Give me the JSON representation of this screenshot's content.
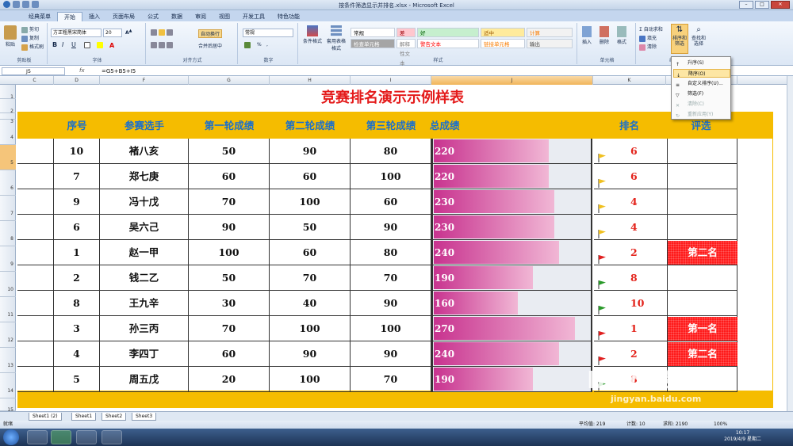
{
  "window": {
    "title": "按条件筛选显示并排名.xlsx - Microsoft Excel",
    "minimize": "–",
    "maximize": "□",
    "close": "✕"
  },
  "tabs": [
    "经典菜单",
    "开始",
    "插入",
    "页面布局",
    "公式",
    "数据",
    "审阅",
    "视图",
    "开发工具",
    "特色功能"
  ],
  "active_tab": "开始",
  "ribbon": {
    "clipboard": {
      "label": "剪贴板",
      "paste": "粘贴",
      "cut": "剪切",
      "copy": "复制",
      "format_painter": "格式刷"
    },
    "font": {
      "label": "字体",
      "name": "方正粗黑宋简体",
      "size": "20",
      "bold": "B",
      "italic": "I",
      "underline": "U"
    },
    "alignment": {
      "label": "对齐方式",
      "wrap": "自动换行",
      "merge": "合并后居中"
    },
    "number": {
      "label": "数字",
      "format": "常规",
      "percent": "%",
      "comma": ","
    },
    "styles": {
      "label": "样式",
      "conditional": "条件格式",
      "table": "套用表格格式",
      "cells": [
        {
          "text": "常规",
          "bg": "#ffffff",
          "color": "#000000"
        },
        {
          "text": "差",
          "bg": "#ffc7ce",
          "color": "#9c0006"
        },
        {
          "text": "好",
          "bg": "#c6efce",
          "color": "#006100"
        },
        {
          "text": "适中",
          "bg": "#ffeb9c",
          "color": "#9c5700"
        },
        {
          "text": "计算",
          "bg": "#f2f2f2",
          "color": "#fa7d00"
        },
        {
          "text": "检查单元格",
          "bg": "#a5a5a5",
          "color": "#ffffff"
        },
        {
          "text": "解释性文本",
          "bg": "#ffffff",
          "color": "#7f7f7f"
        },
        {
          "text": "警告文本",
          "bg": "#ffffff",
          "color": "#ff0000"
        },
        {
          "text": "链接单元格",
          "bg": "#ffffff",
          "color": "#fa7d00"
        },
        {
          "text": "输出",
          "bg": "#f2f2f2",
          "color": "#3f3f3f"
        }
      ]
    },
    "cells": {
      "label": "单元格",
      "insert": "插入",
      "delete": "删除",
      "format": "格式"
    },
    "editing": {
      "label": "编辑",
      "autosum": "自动求和",
      "fill": "填充",
      "clear": "清除",
      "sort_filter": "排序和筛选",
      "find": "查找和选择"
    }
  },
  "formula_bar": {
    "name_box": "J5",
    "fx": "fx",
    "formula": "=G5+B5+I5"
  },
  "columns": [
    "C",
    "D",
    "F",
    "G",
    "H",
    "I",
    "J",
    "K",
    "L"
  ],
  "selected_column": "J",
  "rows": [
    "1",
    "2",
    "3",
    "4",
    "5",
    "6",
    "7",
    "8",
    "9",
    "10",
    "11",
    "12",
    "13",
    "14",
    "15",
    "16"
  ],
  "selected_row": "5",
  "sheet": {
    "title": "竞赛排名演示示例样表",
    "headers": [
      "序号",
      "参赛选手",
      "第一轮成绩",
      "第二轮成绩",
      "第三轮成绩",
      "总成绩",
      "排名",
      "评选"
    ],
    "max_total": 300,
    "records": [
      {
        "no": "10",
        "name": "褚八亥",
        "r1": "50",
        "r2": "90",
        "r3": "80",
        "total": 220,
        "total_text": "220",
        "rank": "6",
        "flag": "yellow",
        "award": ""
      },
      {
        "no": "7",
        "name": "郑七庚",
        "r1": "60",
        "r2": "60",
        "r3": "100",
        "total": 220,
        "total_text": "220",
        "rank": "6",
        "flag": "yellow",
        "award": ""
      },
      {
        "no": "9",
        "name": "冯十戊",
        "r1": "70",
        "r2": "100",
        "r3": "60",
        "total": 230,
        "total_text": "230",
        "rank": "4",
        "flag": "yellow",
        "award": ""
      },
      {
        "no": "6",
        "name": "吴六己",
        "r1": "90",
        "r2": "50",
        "r3": "90",
        "total": 230,
        "total_text": "230",
        "rank": "4",
        "flag": "yellow",
        "award": ""
      },
      {
        "no": "1",
        "name": "赵一甲",
        "r1": "100",
        "r2": "60",
        "r3": "80",
        "total": 240,
        "total_text": "240",
        "rank": "2",
        "flag": "red",
        "award": "第二名"
      },
      {
        "no": "2",
        "name": "钱二乙",
        "r1": "50",
        "r2": "70",
        "r3": "70",
        "total": 190,
        "total_text": "190",
        "rank": "8",
        "flag": "green",
        "award": ""
      },
      {
        "no": "8",
        "name": "王九辛",
        "r1": "30",
        "r2": "40",
        "r3": "90",
        "total": 160,
        "total_text": "160",
        "rank": "10",
        "flag": "green",
        "award": ""
      },
      {
        "no": "3",
        "name": "孙三丙",
        "r1": "70",
        "r2": "100",
        "r3": "100",
        "total": 270,
        "total_text": "270",
        "rank": "1",
        "flag": "red",
        "award": "第一名"
      },
      {
        "no": "4",
        "name": "李四丁",
        "r1": "60",
        "r2": "90",
        "r3": "90",
        "total": 240,
        "total_text": "240",
        "rank": "2",
        "flag": "red",
        "award": "第二名"
      },
      {
        "no": "5",
        "name": "周五戊",
        "r1": "20",
        "r2": "100",
        "r3": "70",
        "total": 190,
        "total_text": "190",
        "rank": "8",
        "flag": "green",
        "award": ""
      }
    ]
  },
  "flag_colors": {
    "red": "#e02020",
    "yellow": "#f0c020",
    "green": "#2a9a2a"
  },
  "sort_menu": {
    "items": [
      {
        "text": "升序(S)",
        "disabled": false,
        "highlight": false
      },
      {
        "text": "降序(O)",
        "disabled": false,
        "highlight": true
      },
      {
        "text": "自定义排序(U)...",
        "disabled": false,
        "highlight": false
      },
      {
        "text": "筛选(F)",
        "disabled": false,
        "highlight": false
      },
      {
        "text": "清除(C)",
        "disabled": true,
        "highlight": false
      },
      {
        "text": "重新应用(Y)",
        "disabled": true,
        "highlight": false
      }
    ]
  },
  "sheet_tabs": [
    "Sheet1 (2)",
    "Sheet1",
    "Sheet2",
    "Sheet3"
  ],
  "status": {
    "ready": "就绪",
    "average": "平均值: 219",
    "count": "计数: 10",
    "sum": "求和: 2190",
    "zoom": "100%"
  },
  "clock": {
    "time": "10:17",
    "date": "2019/4/9 星期二"
  },
  "watermark": {
    "brand": "Baidu经验",
    "url": "jingyan.baidu.com"
  }
}
